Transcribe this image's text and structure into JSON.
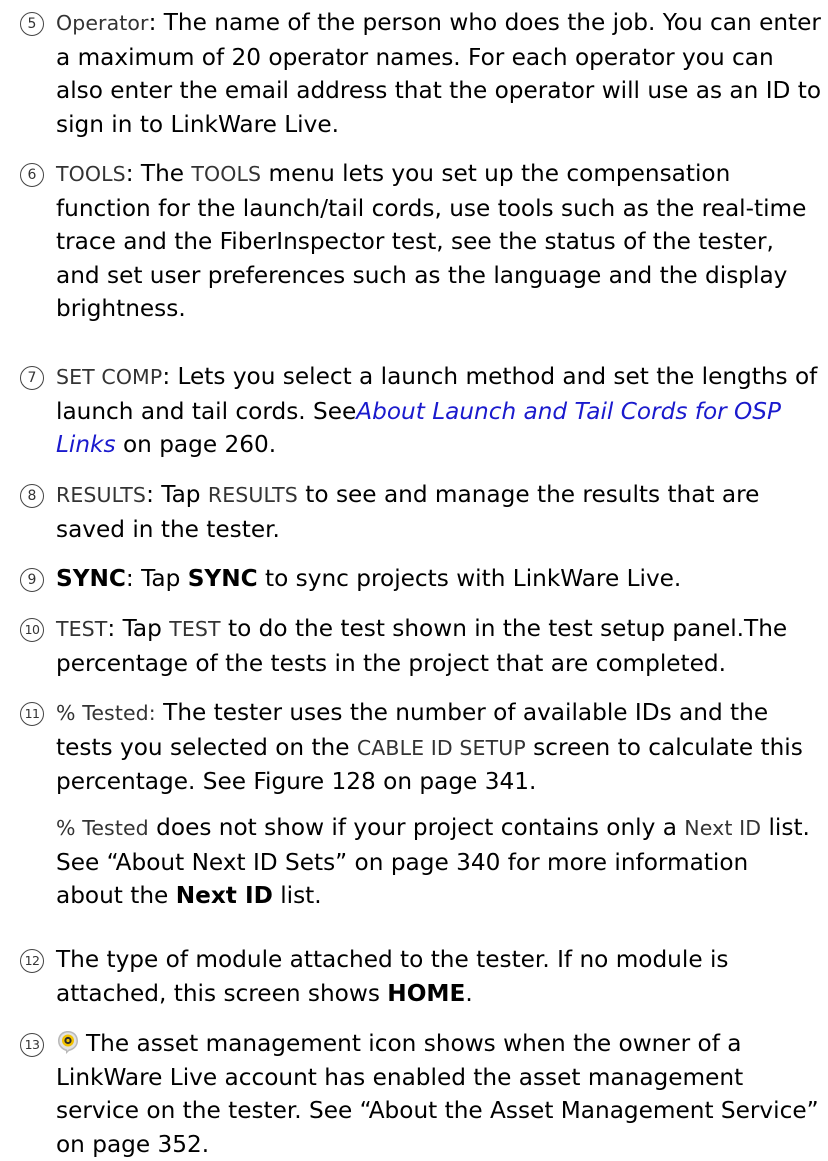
{
  "items": [
    {
      "num": "5",
      "term": "Operator",
      "desc": ": The name of the person who does the job. You can enter a maximum of 20 operator names. For each operator you can also enter the email address that the operator will use as an ID to sign in to LinkWare Live."
    },
    {
      "num": "6",
      "term": "TOOLS",
      "sep": ": The ",
      "term2": "TOOLS",
      "desc": " menu lets you set up the compensation function for the launch/tail cords, use tools such as the real-time trace and the FiberInspector test, see the status of the tester, and set user preferences such as the language and the display brightness."
    },
    {
      "num": "7",
      "term": "SET COMP",
      "desc": ": Lets you select a launch method and set the lengths of launch and tail cords. See",
      "link": "About Launch and Tail Cords for OSP Links",
      "tail": " on page 260."
    },
    {
      "num": "8",
      "term": "RESULTS",
      "sep": ": Tap ",
      "term2": "RESULTS",
      "desc": " to see and manage the results that are saved in the tester."
    },
    {
      "num": "9",
      "term": "SYNC",
      "sep": ": Tap ",
      "term2": "SYNC",
      "desc": " to sync projects with LinkWare Live."
    },
    {
      "num": "10",
      "term": "TEST",
      "sep": ": Tap ",
      "term2": "TEST",
      "desc": " to do the test shown in the test setup panel.The percentage of the tests in the project that are completed."
    },
    {
      "num": "11",
      "term": "% Tested:",
      "desc": " The tester uses the number of available IDs and the tests you selected on the ",
      "term2": "CABLE ID SETUP",
      "tail": " screen to calculate this percentage. See Figure 128 on page 341.",
      "p2_term": "% Tested",
      "p2_a": " does not show if your project contains only a ",
      "p2_term2": "Next ID",
      "p2_b": " list. See “About Next ID Sets” on page 340 for more information about the ",
      "p2_bold": "Next ID",
      "p2_c": " list."
    },
    {
      "num": "12",
      "desc": "The type of module attached to the tester. If no module is attached, this screen shows ",
      "bold": "HOME",
      "tail": "."
    },
    {
      "num": "13",
      "icon": "asset-management-icon",
      "desc": "The asset management icon shows when the owner of a LinkWare Live account has enabled the asset management service on the tester. See “About the Asset Management Service” on page 352."
    }
  ],
  "colors": {
    "link": "#1a1acd",
    "ui_term": "#333333",
    "icon_yellow": "#f2c200"
  }
}
